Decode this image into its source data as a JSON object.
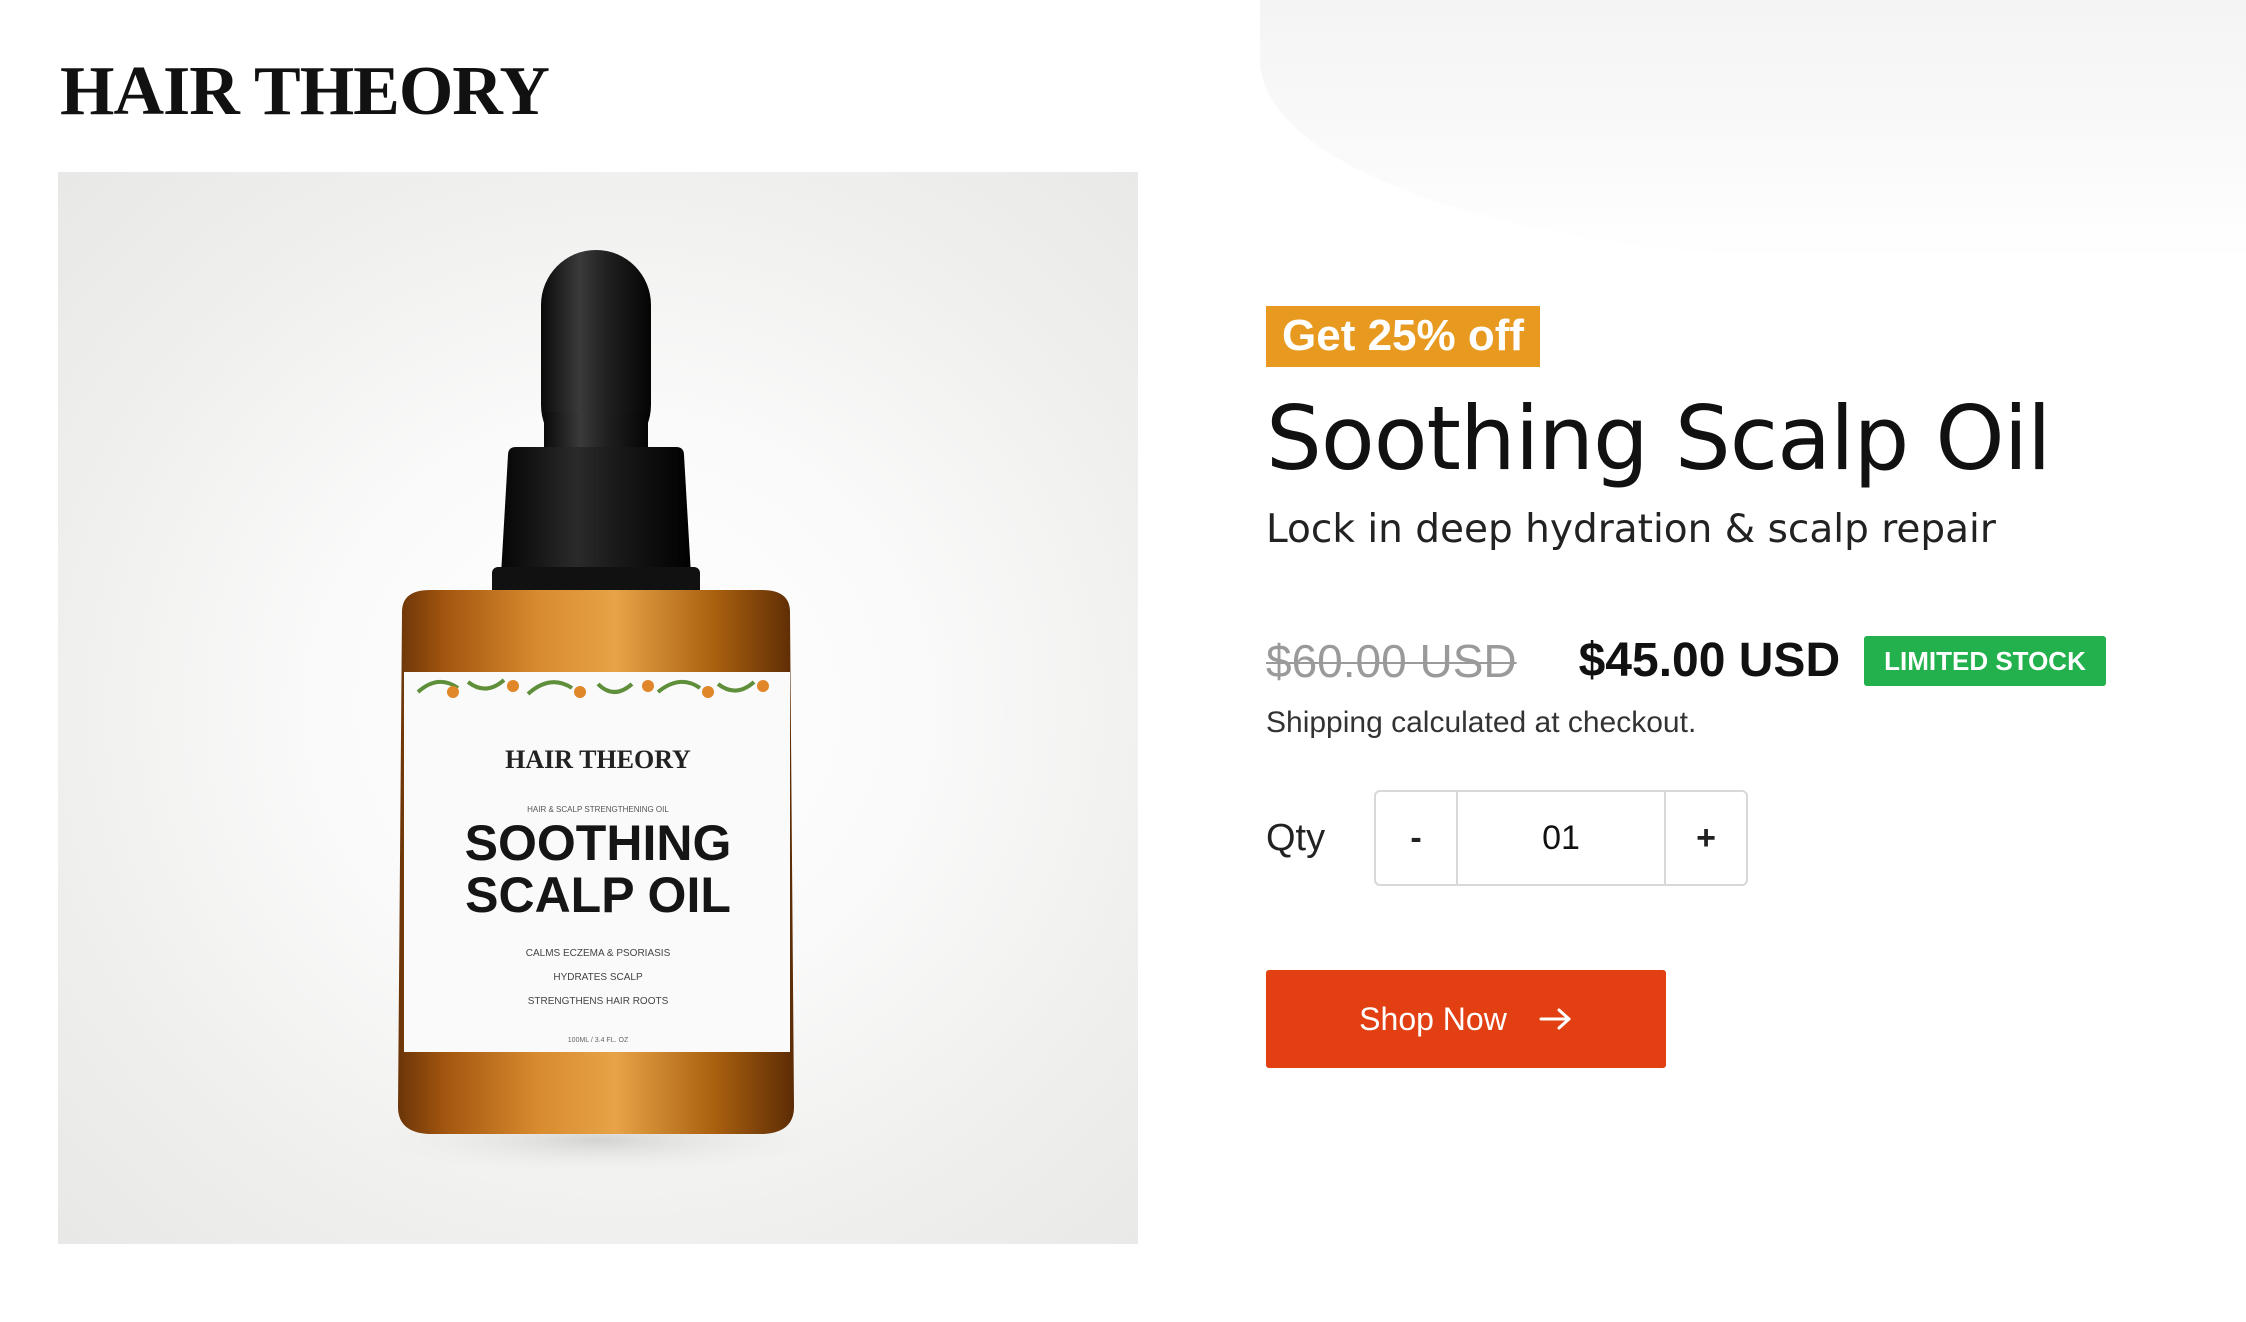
{
  "header": {
    "logo_text": "HAIR THEORY"
  },
  "product_image": {
    "label_brand": "HAIR THEORY",
    "label_tagline": "HAIR & SCALP STRENGTHENING OIL",
    "label_title_line1": "SOOTHING",
    "label_title_line2": "SCALP OIL",
    "label_benefits": [
      "CALMS ECZEMA & PSORIASIS",
      "HYDRATES SCALP",
      "STRENGTHENS HAIR ROOTS"
    ],
    "label_volume": "100ML / 3.4 FL. OZ"
  },
  "product": {
    "promo_badge": "Get 25% off",
    "title": "Soothing Scalp Oil",
    "subtitle": "Lock in deep hydration & scalp repair",
    "old_price": "$60.00 USD",
    "new_price": "$45.00 USD",
    "stock_badge": "LIMITED STOCK",
    "shipping_note": "Shipping calculated at checkout."
  },
  "quantity": {
    "label": "Qty",
    "decrement": "-",
    "value": "01",
    "increment": "+"
  },
  "cta": {
    "label": "Shop Now",
    "icon": "arrow-right-icon"
  },
  "colors": {
    "promo": "#e79a1f",
    "stock": "#22b14c",
    "cta": "#e23f12"
  }
}
